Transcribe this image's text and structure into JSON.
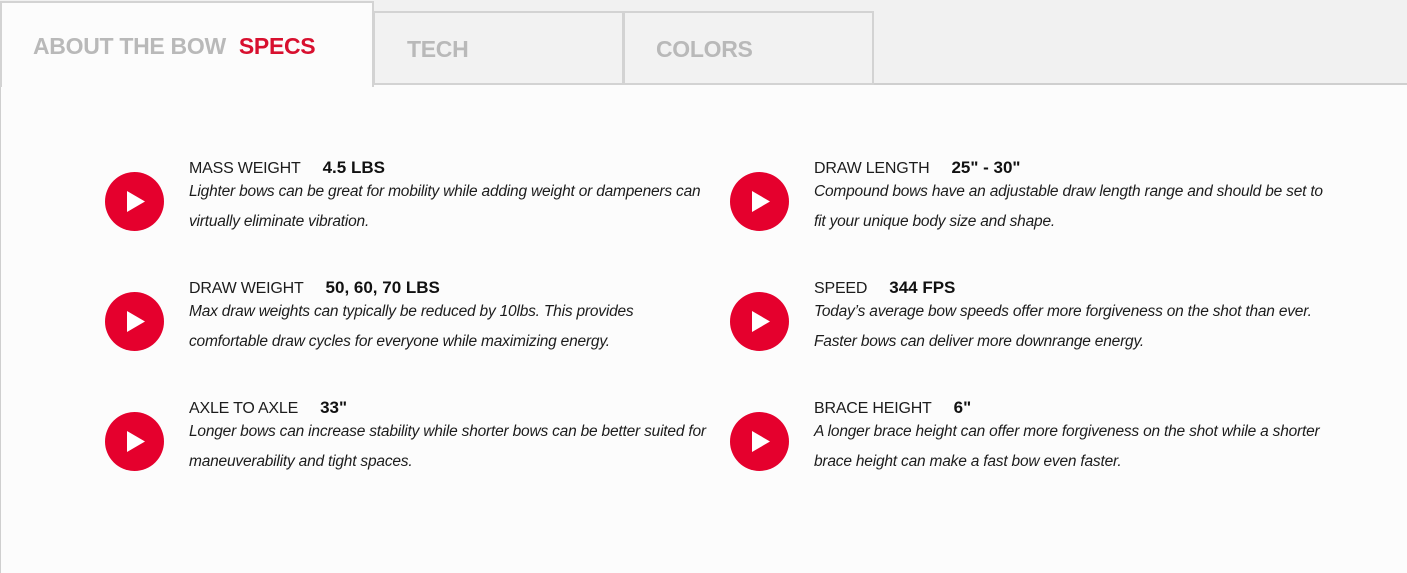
{
  "tabs": {
    "about_label": "ABOUT THE BOW",
    "specs_label": "SPECS",
    "tech_label": "TECH",
    "colors_label": "COLORS"
  },
  "accent_color": "#e5002d",
  "play_icon": "play-icon",
  "specs": [
    {
      "label": "MASS WEIGHT",
      "value": "4.5 LBS",
      "description": "Lighter bows can be great for mobility while adding weight or dampeners can virtually eliminate vibration."
    },
    {
      "label": "DRAW LENGTH",
      "value": "25\" - 30\"",
      "description": "Compound bows have an adjustable draw length range and should be set to fit your unique body size and shape."
    },
    {
      "label": "DRAW WEIGHT",
      "value": "50, 60, 70 LBS",
      "description": "Max draw weights can typically be reduced by 10lbs. This provides comfortable draw cycles for everyone while maximizing energy."
    },
    {
      "label": "SPEED",
      "value": "344 FPS",
      "description": "Today’s average bow speeds offer more forgiveness on the shot than ever. Faster bows can deliver more downrange energy."
    },
    {
      "label": "AXLE TO AXLE",
      "value": "33\"",
      "description": "Longer bows can increase stability while shorter bows can be better suited for maneuverability and tight spaces."
    },
    {
      "label": "BRACE HEIGHT",
      "value": "6\"",
      "description": "A longer brace height can offer more forgiveness on the shot while a shorter brace height can make a fast bow even faster."
    }
  ]
}
